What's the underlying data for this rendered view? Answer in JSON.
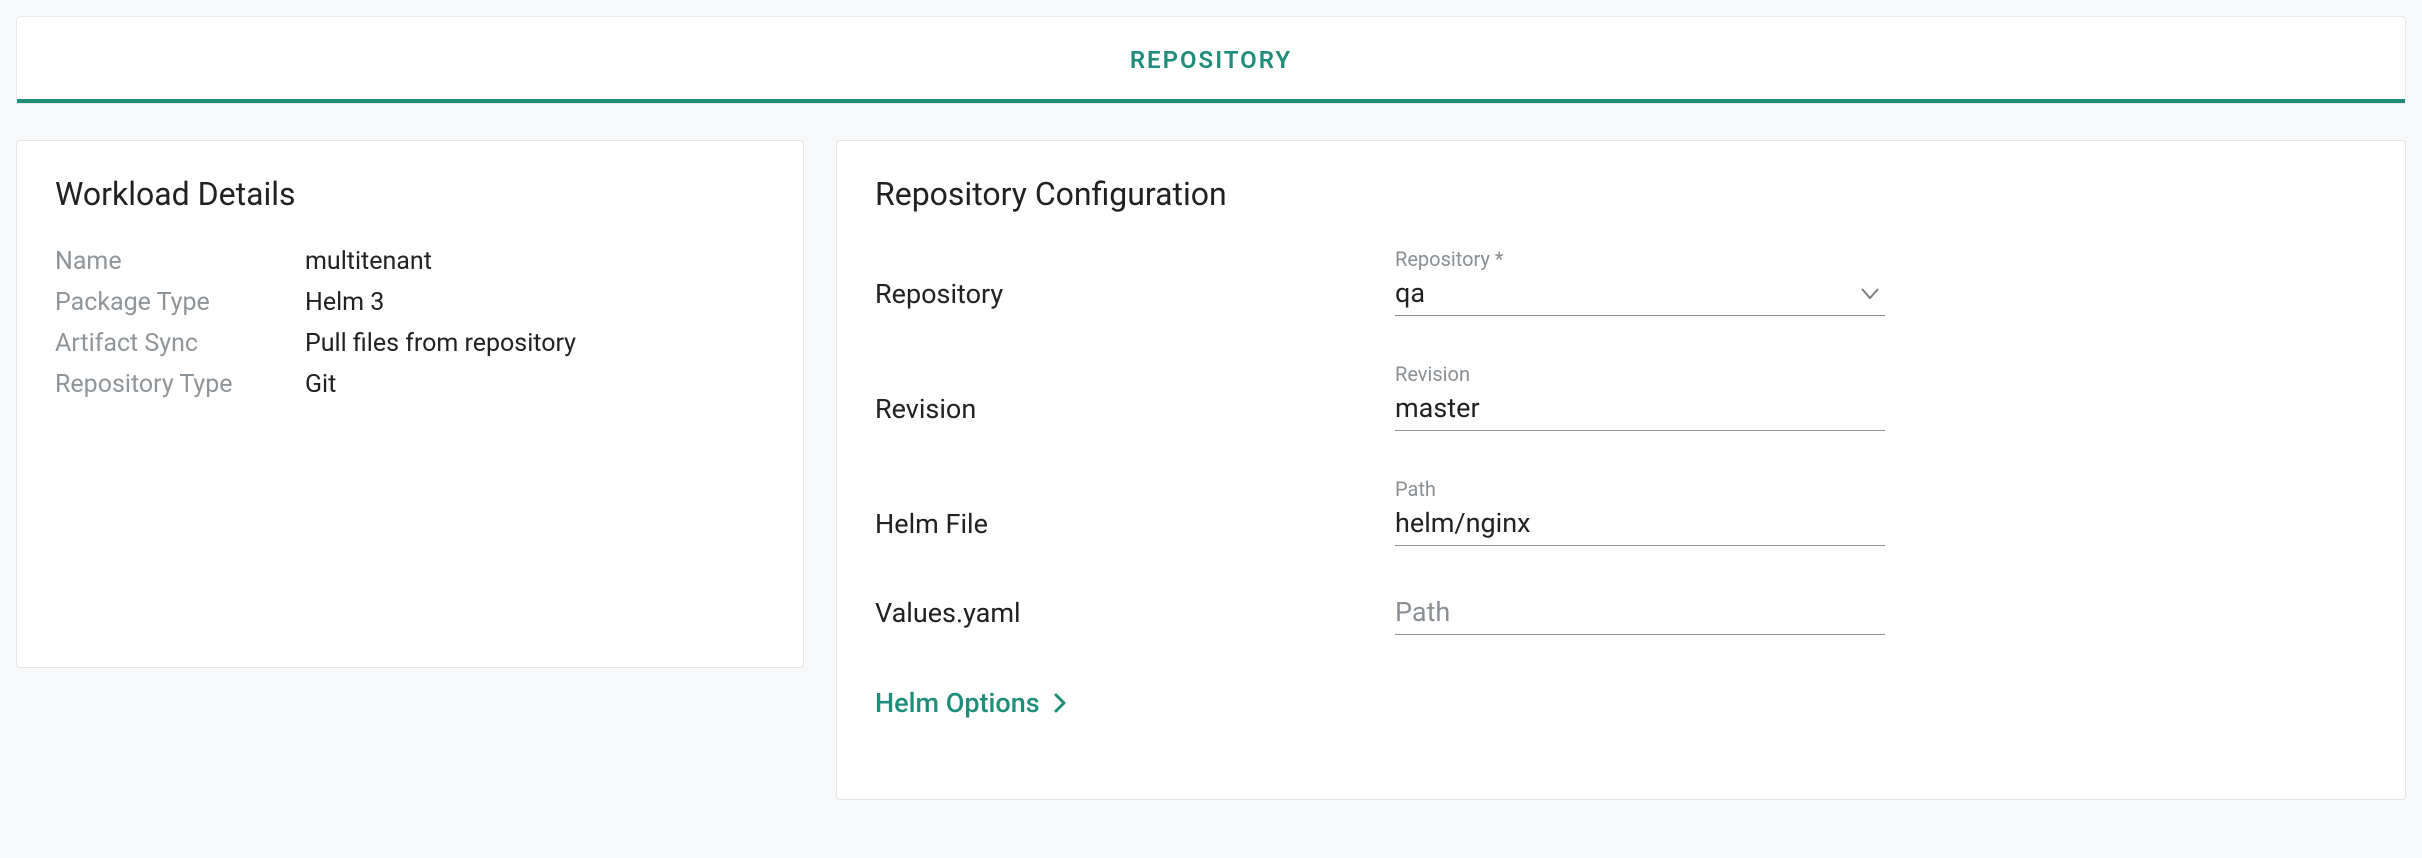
{
  "tab": {
    "repository": "REPOSITORY"
  },
  "details": {
    "title": "Workload Details",
    "rows": {
      "name_label": "Name",
      "name_value": "multitenant",
      "package_label": "Package Type",
      "package_value": "Helm 3",
      "sync_label": "Artifact Sync",
      "sync_value": "Pull files from repository",
      "repo_type_label": "Repository Type",
      "repo_type_value": "Git"
    }
  },
  "config": {
    "title": "Repository Configuration",
    "rows": {
      "repository_label": "Repository",
      "revision_label": "Revision",
      "helm_file_label": "Helm File",
      "values_label": "Values.yaml"
    },
    "fields": {
      "repository": {
        "float": "Repository *",
        "value": "qa"
      },
      "revision": {
        "float": "Revision",
        "value": "master"
      },
      "path": {
        "float": "Path",
        "value": "helm/nginx"
      },
      "values": {
        "placeholder": "Path",
        "value": ""
      }
    },
    "helm_options": "Helm Options"
  }
}
